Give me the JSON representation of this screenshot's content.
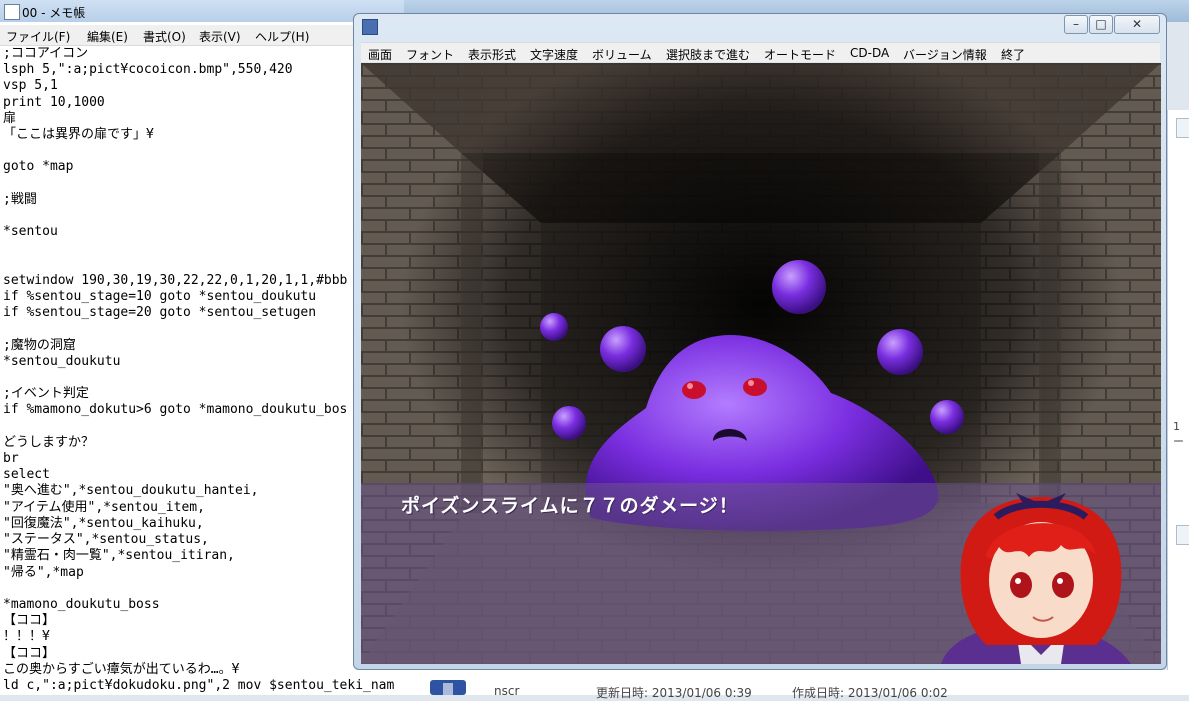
{
  "notepad": {
    "title": "00 - メモ帳",
    "menu": [
      "ファイル(F)",
      "編集(E)",
      "書式(O)",
      "表示(V)",
      "ヘルプ(H)"
    ],
    "text": ";ココアイコン\nlsph 5,\":a;pict¥cocoicon.bmp\",550,420\nvsp 5,1\nprint 10,1000\n扉\n「ここは異界の扉です」¥\n\ngoto *map\n\n;戦闘\n\n*sentou\n\n\nsetwindow 190,30,19,30,22,22,0,1,20,1,1,#bbb\nif %sentou_stage=10 goto *sentou_doukutu\nif %sentou_stage=20 goto *sentou_setugen\n\n;魔物の洞窟\n*sentou_doukutu\n\n;イベント判定\nif %mamono_dokutu>6 goto *mamono_doukutu_bos\n\nどうしますか？\nbr\nselect\n\"奥へ進む\",*sentou_doukutu_hantei,\n\"アイテム使用\",*sentou_item,\n\"回復魔法\",*sentou_kaihuku,\n\"ステータス\",*sentou_status,\n\"精霊石・肉一覧\",*sentou_itiran,\n\"帰る\",*map\n\n*mamono_doukutu_boss\n【ココ】\n！！！¥\n【ココ】\nこの奥からすごい瘴気が出ているわ…。¥\nld c,\":a;pict¥dokudoku.png\",2 mov $sentou_teki_nam"
  },
  "game": {
    "menu": [
      "画面",
      "フォント",
      "表示形式",
      "文字速度",
      "ボリューム",
      "選択肢まで進む",
      "オートモード",
      "CD-DA",
      "バージョン情報",
      "終了"
    ],
    "message": "ポイズンスライムに７７のダメージ！",
    "slime_color": "#7a2ee0",
    "text_box_color": "#6e558c"
  },
  "explorer": {
    "side_label": "1ー",
    "file_name": "nscr",
    "modified": "更新日時: 2013/01/06 0:39",
    "created": "作成日時: 2013/01/06 0:02"
  }
}
